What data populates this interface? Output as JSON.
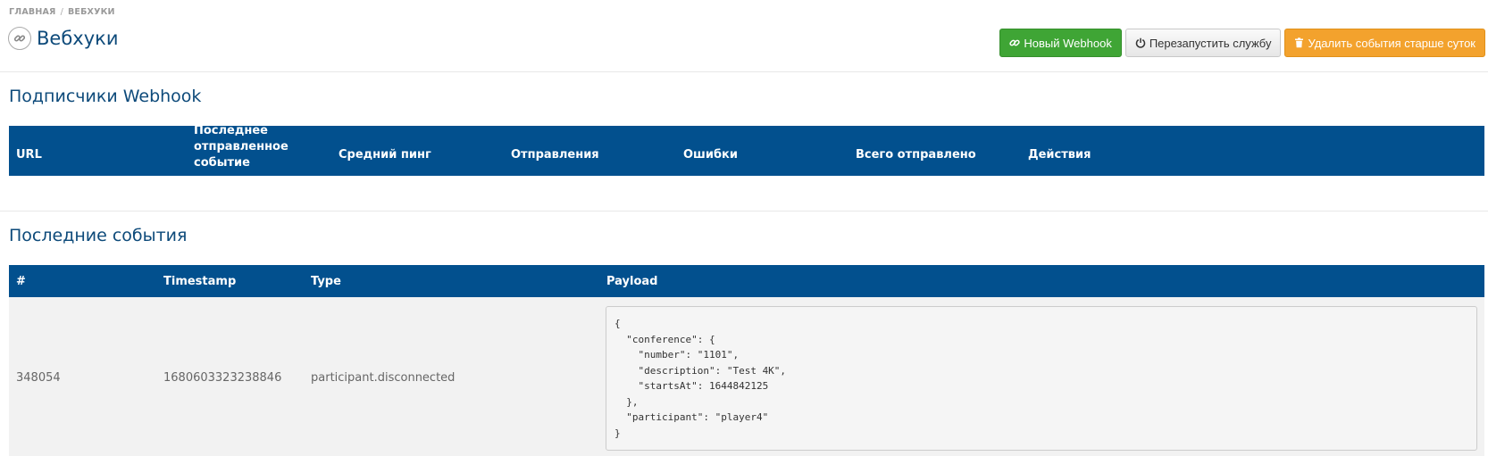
{
  "breadcrumb": {
    "home": "ГЛАВНАЯ",
    "separator": "/",
    "current": "ВЕБХУКИ"
  },
  "header": {
    "title": "Вебхуки",
    "icon": "link-icon"
  },
  "toolbar": {
    "new_webhook": "Новый Webhook",
    "restart_service": "Перезапустить службу",
    "delete_old_events": "Удалить события старше суток"
  },
  "subscribers": {
    "title": "Подписчики Webhook",
    "columns": {
      "url": "URL",
      "last_event_line1": "Последнее",
      "last_event_line2": "отправленное событие",
      "avg_ping": "Средний пинг",
      "sends": "Отправления",
      "errors": "Ошибки",
      "total_sent": "Всего отправлено",
      "actions": "Действия"
    },
    "rows": []
  },
  "events": {
    "title": "Последние события",
    "columns": {
      "id": "#",
      "timestamp": "Timestamp",
      "type": "Type",
      "payload": "Payload"
    },
    "rows": [
      {
        "id": "348054",
        "timestamp": "1680603323238846",
        "type": "participant.disconnected",
        "payload": "{\n  \"conference\": {\n    \"number\": \"1101\",\n    \"description\": \"Test 4K\",\n    \"startsAt\": 1644842125\n  },\n  \"participant\": \"player4\"\n}"
      }
    ]
  },
  "colors": {
    "primary_text": "#0d4a7a",
    "table_header_bg": "#02508e",
    "btn_green": "#3fa535",
    "btn_orange": "#f3a22d"
  }
}
